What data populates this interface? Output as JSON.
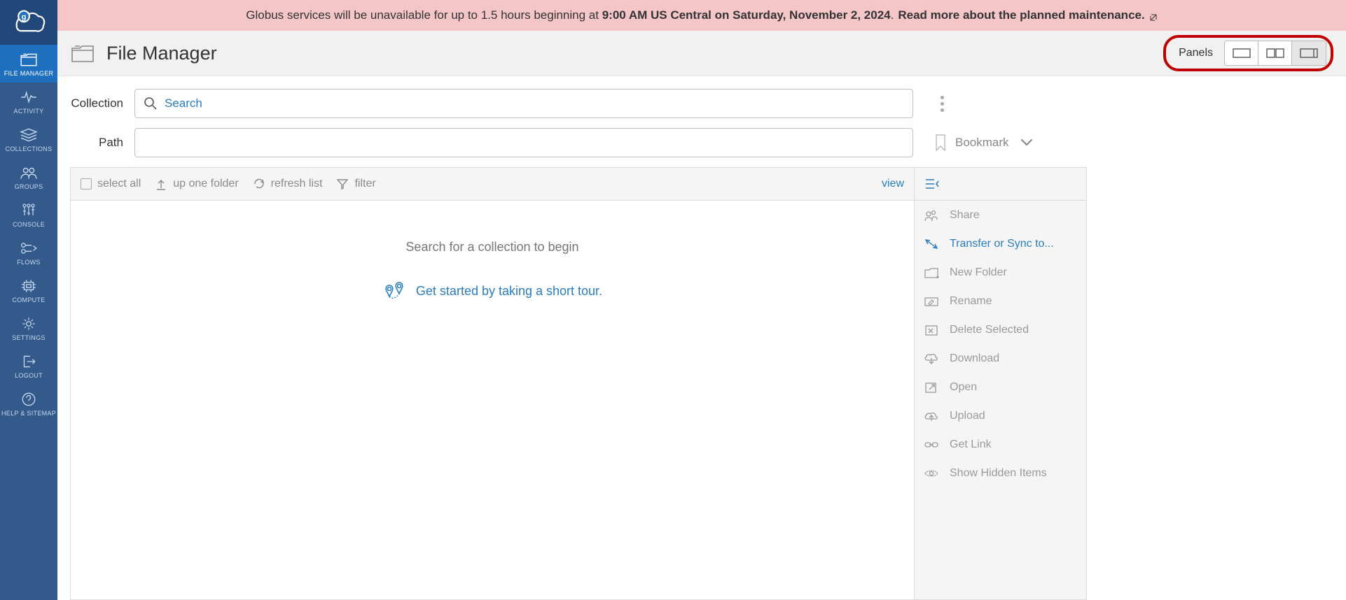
{
  "banner": {
    "pre": "Globus services will be unavailable for up to 1.5 hours beginning at ",
    "bold": "9:00 AM US Central on Saturday, November 2, 2024",
    "post": ". ",
    "link": "Read more about the planned maintenance."
  },
  "sidebar": [
    {
      "label": "FILE MANAGER",
      "active": true
    },
    {
      "label": "ACTIVITY"
    },
    {
      "label": "COLLECTIONS"
    },
    {
      "label": "GROUPS"
    },
    {
      "label": "CONSOLE"
    },
    {
      "label": "FLOWS"
    },
    {
      "label": "COMPUTE"
    },
    {
      "label": "SETTINGS"
    },
    {
      "label": "LOGOUT"
    },
    {
      "label": "HELP & SITEMAP"
    }
  ],
  "header": {
    "title": "File Manager",
    "panels_label": "Panels"
  },
  "fields": {
    "collection_label": "Collection",
    "path_label": "Path",
    "search_placeholder": "Search",
    "bookmark_label": "Bookmark"
  },
  "toolbar": {
    "select_all": "select all",
    "up_one": "up one folder",
    "refresh": "refresh list",
    "filter": "filter",
    "view": "view"
  },
  "content": {
    "empty": "Search for a collection to begin",
    "tour": "Get started by taking a short tour."
  },
  "actions": [
    {
      "label": "Share",
      "enabled": false
    },
    {
      "label": "Transfer or Sync to...",
      "enabled": true
    },
    {
      "label": "New Folder",
      "enabled": false
    },
    {
      "label": "Rename",
      "enabled": false
    },
    {
      "label": "Delete Selected",
      "enabled": false
    },
    {
      "label": "Download",
      "enabled": false
    },
    {
      "label": "Open",
      "enabled": false
    },
    {
      "label": "Upload",
      "enabled": false
    },
    {
      "label": "Get Link",
      "enabled": false
    },
    {
      "label": "Show Hidden Items",
      "enabled": false
    }
  ]
}
